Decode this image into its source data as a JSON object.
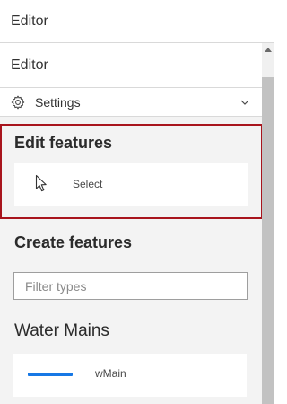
{
  "window": {
    "title": "Editor"
  },
  "panel": {
    "title": "Editor",
    "settings": {
      "label": "Settings",
      "icon": "gear-icon",
      "chevron": "chevron-down-icon"
    },
    "edit_features": {
      "heading": "Edit features",
      "select": {
        "label": "Select",
        "icon": "cursor-icon"
      }
    },
    "create_features": {
      "heading": "Create features",
      "filter": {
        "placeholder": "Filter types",
        "value": ""
      }
    },
    "layers": [
      {
        "heading": "Water Mains",
        "templates": [
          {
            "label": "wMain",
            "symbol_color": "#1778e5"
          }
        ]
      }
    ]
  },
  "colors": {
    "highlight_border": "#a8141d",
    "accent": "#1778e5"
  }
}
